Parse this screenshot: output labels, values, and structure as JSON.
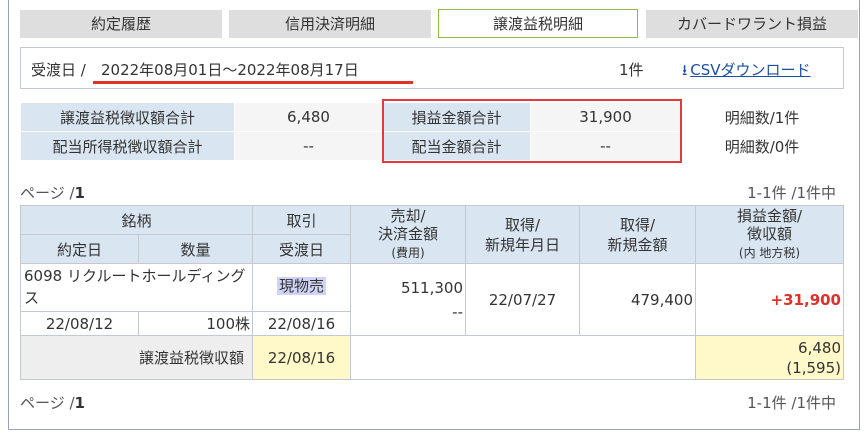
{
  "tabs": [
    {
      "label": "約定履歴"
    },
    {
      "label": "信用決済明細"
    },
    {
      "label": "譲渡益税明細"
    },
    {
      "label": "カバードワラント損益"
    }
  ],
  "date_filter": {
    "label": "受渡日",
    "separator": "/",
    "range": "2022年08月01日～2022年08月17日",
    "count": "1件",
    "csv_label": "CSVダウンロード"
  },
  "summary": {
    "rows": [
      {
        "label1": "譲渡益税徴収額合計",
        "value1": "6,480",
        "label2": "損益金額合計",
        "value2": "31,900",
        "count": "明細数/1件"
      },
      {
        "label1": "配当所得税徴収額合計",
        "value1": "--",
        "label2": "配当金額合計",
        "value2": "--",
        "count": "明細数/0件"
      }
    ]
  },
  "pager": {
    "prefix": "ページ /",
    "page": "1",
    "range": "1-1件 /1件中"
  },
  "detail": {
    "headers": {
      "stock": "銘柄",
      "trade": "取引",
      "sale_line1": "売却/",
      "sale_line2": "決済金額",
      "sale_sub": "(費用)",
      "acq_date_line1": "取得/",
      "acq_date_line2": "新規年月日",
      "acq_amount_line1": "取得/",
      "acq_amount_line2": "新規金額",
      "pl_line1": "損益金額/",
      "pl_line2": "徴収額",
      "pl_sub": "(内 地方税)",
      "contract_date": "約定日",
      "quantity": "数量",
      "settle_date": "受渡日"
    },
    "row": {
      "stock_name": "6098 リクルートホールディングス",
      "trade_type": "現物売",
      "sale_amount": "511,300",
      "sale_cost": "--",
      "acq_date": "22/07/27",
      "acq_amount": "479,400",
      "pl": "+31,900",
      "contract_date": "22/08/12",
      "quantity": "100株",
      "settle_date": "22/08/16"
    },
    "tax_row": {
      "label": "譲渡益税徴収額",
      "date": "22/08/16",
      "amount": "6,480",
      "local": "(1,595)"
    }
  },
  "colors": {
    "accent_red": "#e0302a",
    "header_blue": "#d9e6f2",
    "link_blue": "#1a4fa8",
    "highlight_yellow": "#fff8c8"
  }
}
